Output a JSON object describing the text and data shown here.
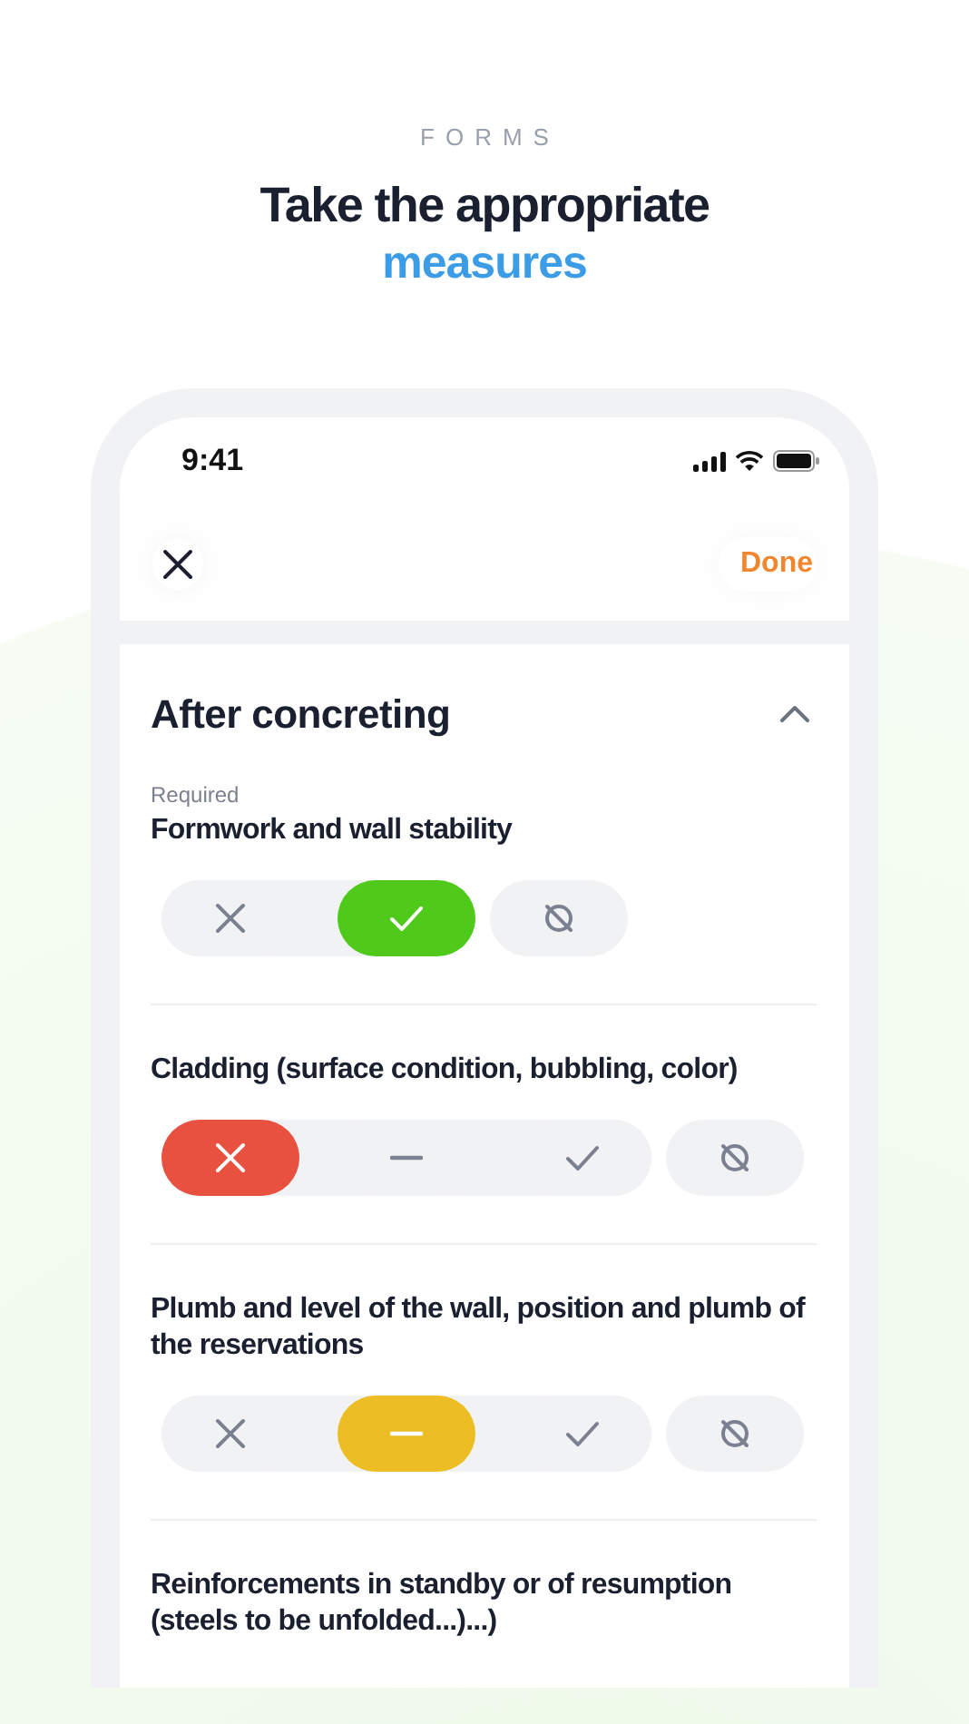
{
  "eyebrow": "FORMS",
  "headline": {
    "line_1": "Take the appropriate",
    "line_2": "measures"
  },
  "status_bar": {
    "time": "9:41"
  },
  "nav": {
    "done": "Done"
  },
  "sections": [
    {
      "title": "After concreting",
      "expanded": true,
      "items": [
        {
          "required": "Required",
          "title": "Formwork and wall stability",
          "options": [
            {
              "kind": "fail",
              "selected": false
            },
            {
              "kind": "pass",
              "selected": true
            }
          ],
          "na": {
            "selected": false
          }
        },
        {
          "title": "Cladding (surface condition, bubbling, color)",
          "options": [
            {
              "kind": "fail",
              "selected": true
            },
            {
              "kind": "partial",
              "selected": false
            },
            {
              "kind": "pass",
              "selected": false
            }
          ],
          "na": {
            "selected": false
          }
        },
        {
          "title": "Plumb and level of the wall, position and plumb of the reservations",
          "options": [
            {
              "kind": "fail",
              "selected": false
            },
            {
              "kind": "partial",
              "selected": true
            },
            {
              "kind": "pass",
              "selected": false
            }
          ],
          "na": {
            "selected": false
          }
        },
        {
          "title": "Reinforcements in standby or of resumption (steels to be unfolded...)...)"
        }
      ]
    }
  ]
}
